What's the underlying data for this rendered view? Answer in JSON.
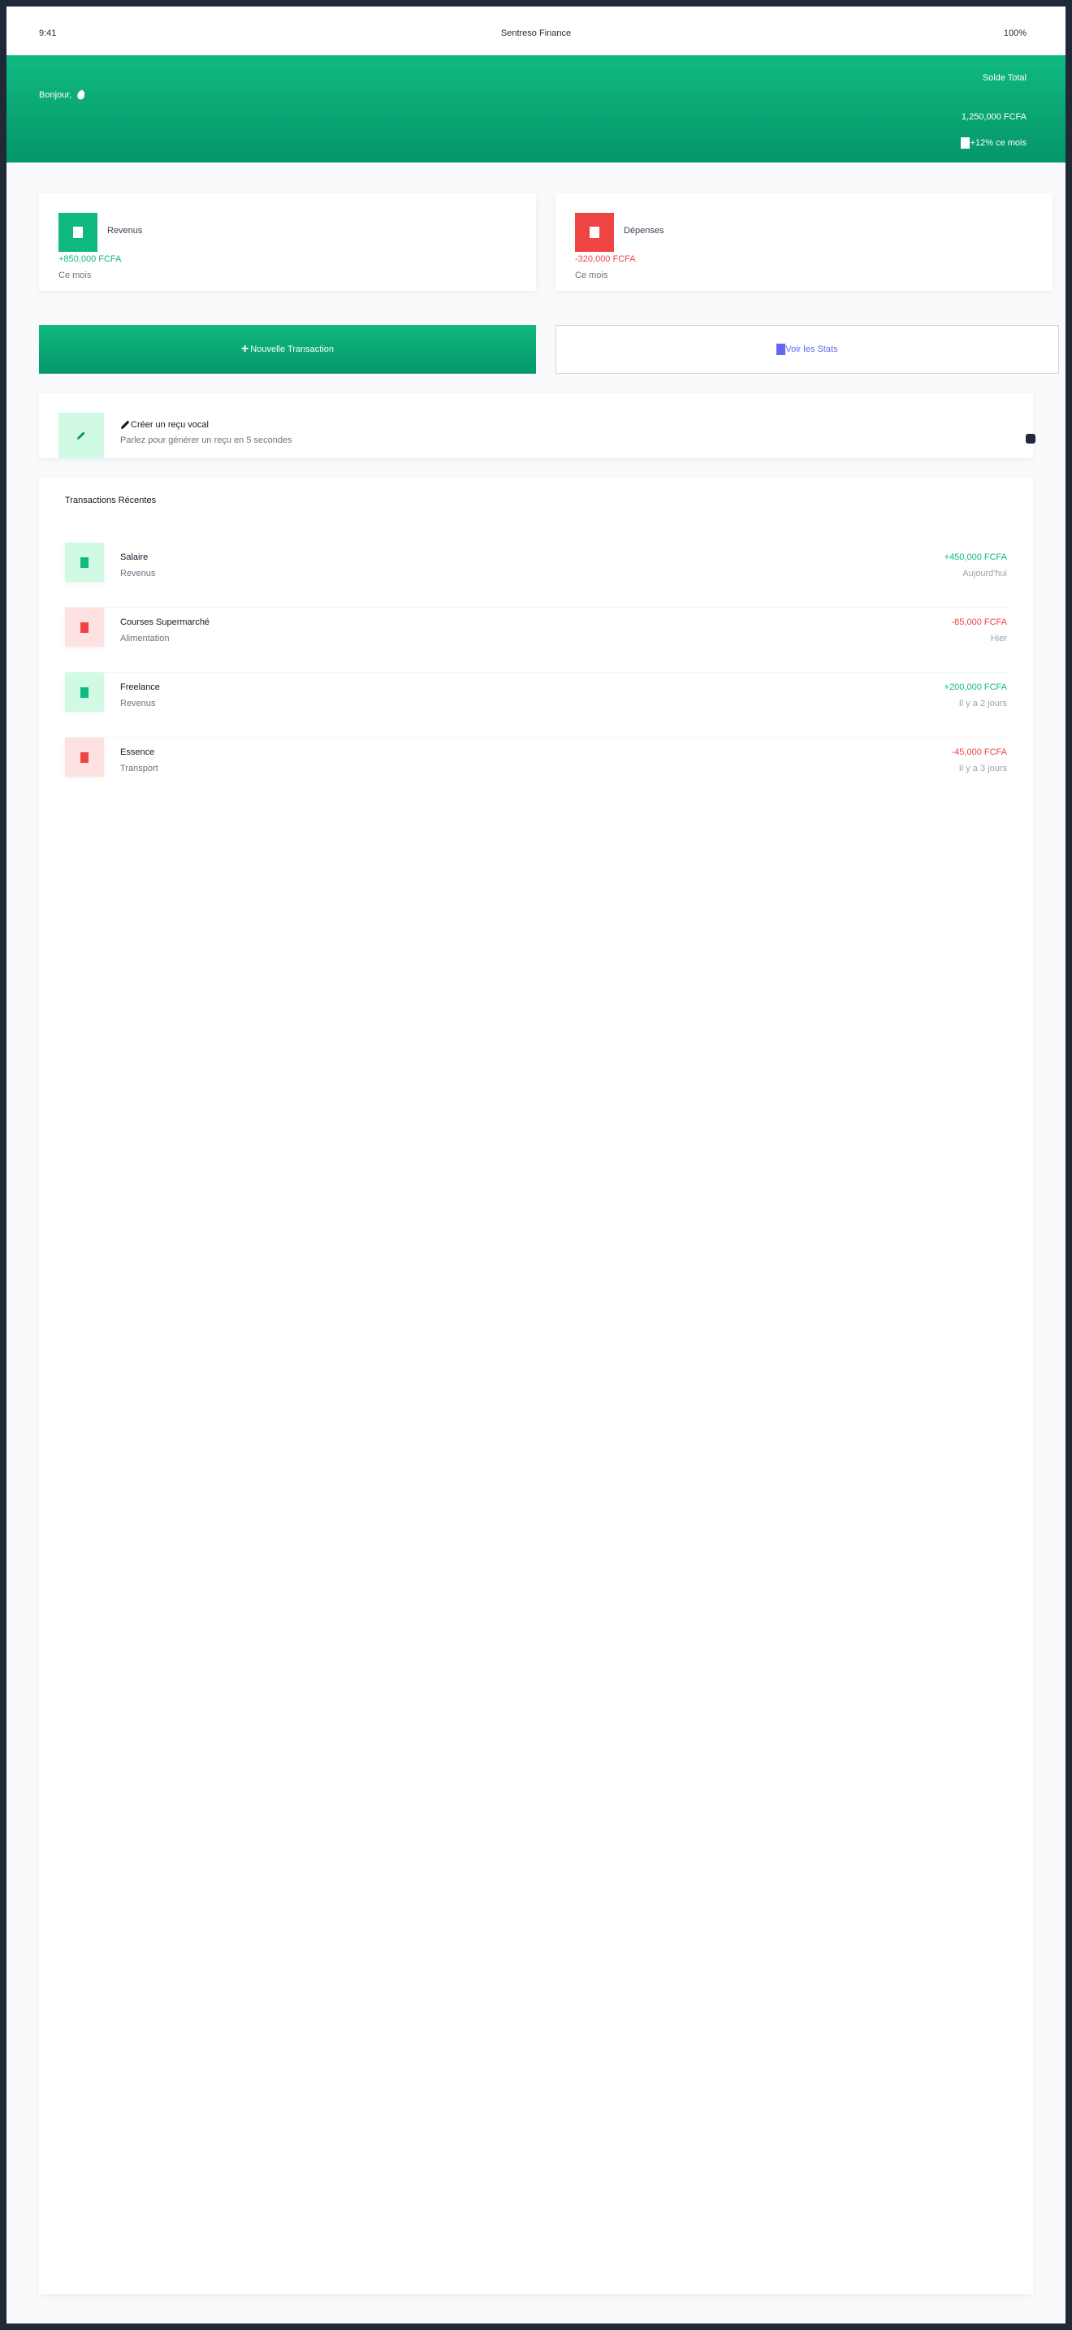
{
  "status_bar": {
    "time": "9:41",
    "app_name": "Sentreso Finance",
    "battery": "100%"
  },
  "hero": {
    "greeting": "Bonjour,",
    "balance_label": "Solde Total",
    "balance_value": "1,250,000 FCFA",
    "trend": "+12% ce mois"
  },
  "stats": {
    "income": {
      "title": "Revenus",
      "value": "+850,000 FCFA",
      "period": "Ce mois"
    },
    "expense": {
      "title": "Dépenses",
      "value": "-320,000 FCFA",
      "period": "Ce mois"
    }
  },
  "actions": {
    "new_transaction": "Nouvelle Transaction",
    "view_stats": "Voir les Stats"
  },
  "voice": {
    "title": "Créer un reçu vocal",
    "subtitle": "Parlez pour générer un reçu en 5 secondes"
  },
  "transactions": {
    "heading": "Transactions Récentes",
    "items": [
      {
        "name": "Salaire",
        "category": "Revenus",
        "amount": "+450,000 FCFA",
        "date": "Aujourd'hui",
        "type": "pos"
      },
      {
        "name": "Courses Supermarché",
        "category": "Alimentation",
        "amount": "-85,000 FCFA",
        "date": "Hier",
        "type": "neg"
      },
      {
        "name": "Freelance",
        "category": "Revenus",
        "amount": "+200,000 FCFA",
        "date": "Il y a 2 jours",
        "type": "pos"
      },
      {
        "name": "Essence",
        "category": "Transport",
        "amount": "-45,000 FCFA",
        "date": "Il y a 3 jours",
        "type": "neg"
      }
    ]
  },
  "colors": {
    "brand": "#10b981",
    "brand_dark": "#059669",
    "expense": "#ef4444",
    "stats_accent": "#6366f1"
  }
}
